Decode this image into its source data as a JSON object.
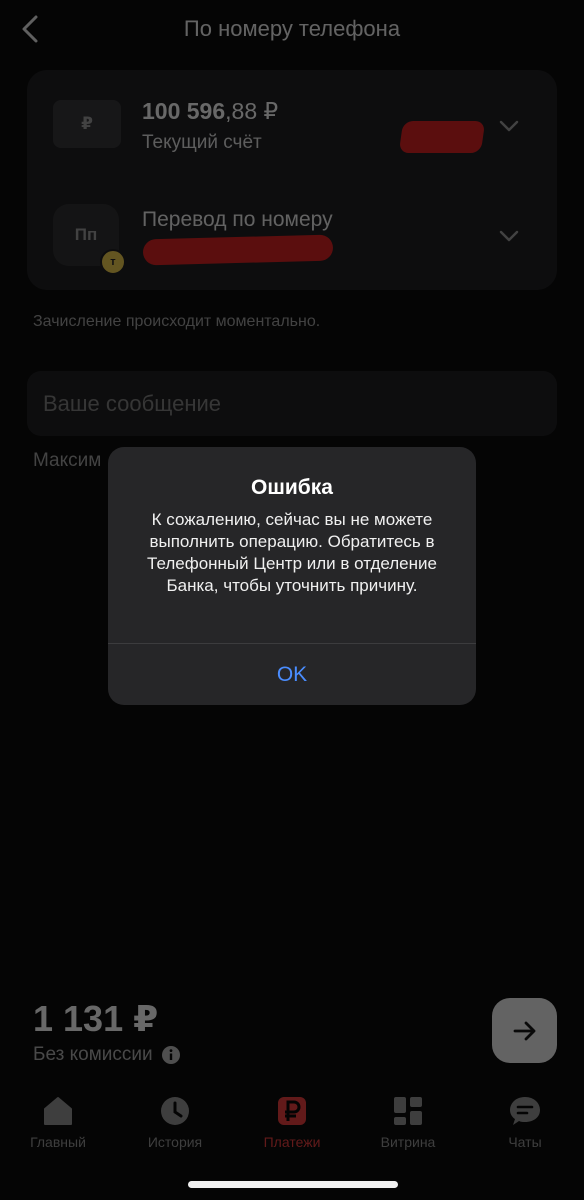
{
  "header": {
    "title": "По номеру телефона"
  },
  "account": {
    "icon_text": "₽",
    "balance_int": "100 596",
    "balance_frac": ",88 ₽",
    "label": "Текущий счёт"
  },
  "transfer": {
    "icon_text": "Пп",
    "badge_text": "т",
    "label": "Перевод по номеру"
  },
  "note": "Зачисление происходит моментально.",
  "message": {
    "placeholder": "Ваше сообщение",
    "value": ""
  },
  "max_label": "Максим",
  "footer": {
    "amount": "1 131 ₽",
    "commission": "Без комиссии"
  },
  "tabs": [
    {
      "label": "Главный",
      "icon": "home-icon"
    },
    {
      "label": "История",
      "icon": "clock-icon"
    },
    {
      "label": "Платежи",
      "icon": "ruble-icon",
      "active": true
    },
    {
      "label": "Витрина",
      "icon": "grid-icon"
    },
    {
      "label": "Чаты",
      "icon": "chat-icon"
    }
  ],
  "dialog": {
    "title": "Ошибка",
    "message": "К сожалению, сейчас вы не можете выполнить операцию. Обратитесь в Телефонный Центр или в отделение Банка, чтобы уточнить причину.",
    "ok_label": "OK"
  },
  "colors": {
    "accent": "#e53a3a",
    "ok_blue": "#4a8dff",
    "redaction": "#d31d1d",
    "badge": "#e8c64a"
  }
}
